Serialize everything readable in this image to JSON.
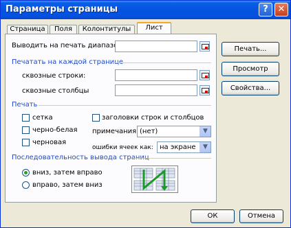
{
  "window": {
    "title": "Параметры страницы"
  },
  "tabs": [
    {
      "label": "Страница"
    },
    {
      "label": "Поля"
    },
    {
      "label": "Колонтитулы"
    },
    {
      "label": "Лист"
    }
  ],
  "print_area": {
    "label": "Выводить на печать диапазон:",
    "value": ""
  },
  "print_titles": {
    "group_label": "Печатать на каждой странице",
    "rows_label": "сквозные строки:",
    "rows_value": "",
    "cols_label": "сквозные столбцы",
    "cols_value": ""
  },
  "print": {
    "group_label": "Печать",
    "gridlines": {
      "label": "сетка",
      "checked": false
    },
    "black_white": {
      "label": "черно-белая",
      "checked": false
    },
    "draft": {
      "label": "черновая",
      "checked": false
    },
    "headings": {
      "label": "заголовки строк и столбцов",
      "checked": false
    },
    "comments_label": "примечания:",
    "comments_value": "(нет)",
    "errors_label": "ошибки ячеек как:",
    "errors_value": "на экране"
  },
  "page_order": {
    "group_label": "Последовательность вывода страниц",
    "down_then_over": "вниз, затем вправо",
    "over_then_down": "вправо, затем вниз",
    "selected": "down_then_over"
  },
  "buttons": {
    "print": "Печать...",
    "preview": "Просмотр",
    "options": "Свойства...",
    "ok": "ОК",
    "cancel": "Отмена"
  },
  "caption_buttons": {
    "help": "?",
    "close": "✕"
  }
}
